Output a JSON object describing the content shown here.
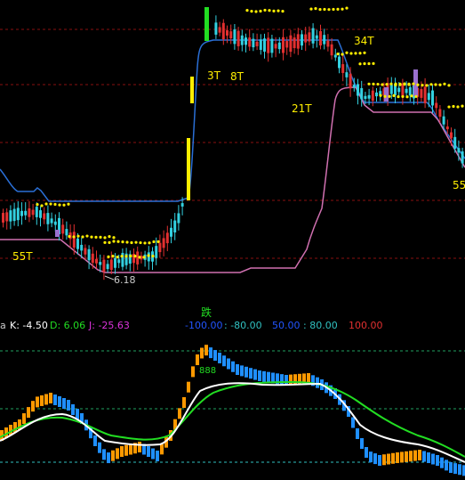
{
  "price_panel": {
    "labels": {
      "t55_left": "55T",
      "t3": "3T",
      "t8": "8T",
      "t34": "34T",
      "t21": "21T",
      "t55_right": "55",
      "low_price": "6.18"
    }
  },
  "signal": {
    "text": "跌",
    "color": "#22dd22"
  },
  "kdj_header": {
    "prefix": "a",
    "k": "K: -4.50",
    "d": "D: 6.06",
    "j": "J: -25.63",
    "lvl_n100": "-100.00",
    "lvl_n80": ": -80.00",
    "lvl_50": "50.00",
    "lvl_80": ": 80.00",
    "lvl_100": "100.00"
  },
  "kdj_panel": {
    "peak_label": "888"
  },
  "colors": {
    "background": "#000000",
    "blue_line": "#2a6fd6",
    "pink_line": "#d070b0",
    "up_candle": "#e23030",
    "down_candle": "#33d0e0",
    "yellow_dots": "#ffee00",
    "k_color": "#ffffff",
    "d_color": "#22dd22",
    "j_color": "#dd33dd",
    "orange_hist": "#ff9900",
    "blue_hist": "#1f8fff",
    "grid_red": "#8a1010",
    "grid_green": "#20a060",
    "grid_cyan": "#30c0c0"
  }
}
